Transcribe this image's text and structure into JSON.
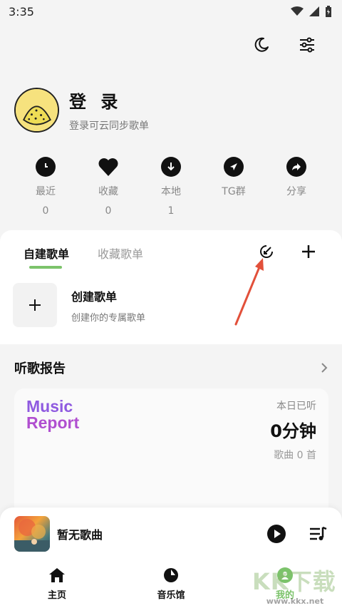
{
  "status_bar": {
    "time": "3:35",
    "icons": [
      "wifi-icon",
      "signal-icon",
      "battery-icon"
    ]
  },
  "top_actions": {
    "icons": [
      "moon-icon",
      "sliders-icon"
    ]
  },
  "profile": {
    "title": "登 录",
    "subtitle": "登录可云同步歌单"
  },
  "quick": [
    {
      "label": "最近",
      "count": "0",
      "icon": "clock-icon"
    },
    {
      "label": "收藏",
      "count": "0",
      "icon": "heart-icon"
    },
    {
      "label": "本地",
      "count": "1",
      "icon": "download-icon"
    },
    {
      "label": "TG群",
      "count": "",
      "icon": "telegram-icon"
    },
    {
      "label": "分享",
      "count": "",
      "icon": "share-icon"
    }
  ],
  "playlist": {
    "tabs": [
      {
        "label": "自建歌单",
        "active": true
      },
      {
        "label": "收藏歌单",
        "active": false
      }
    ],
    "create_title": "创建歌单",
    "create_sub": "创建你的专属歌单"
  },
  "report": {
    "header": "听歌报告",
    "logo_line1": "Music",
    "logo_line2": "Report",
    "today_label": "本日已听",
    "today_value": "0分钟",
    "songs_label": "歌曲 0 首"
  },
  "player": {
    "now_playing": "暂无歌曲"
  },
  "nav": [
    {
      "label": "主页",
      "icon": "home-icon",
      "active": false
    },
    {
      "label": "音乐馆",
      "icon": "music-hall-icon",
      "active": false
    },
    {
      "label": "我的",
      "icon": "profile-icon",
      "active": true
    }
  ],
  "watermark": {
    "big": "KK下载",
    "small": "www.kkx.net"
  },
  "colors": {
    "accent": "#7cc36b",
    "arrow": "#e2503a",
    "logo_purple": "#8f5ae0"
  }
}
